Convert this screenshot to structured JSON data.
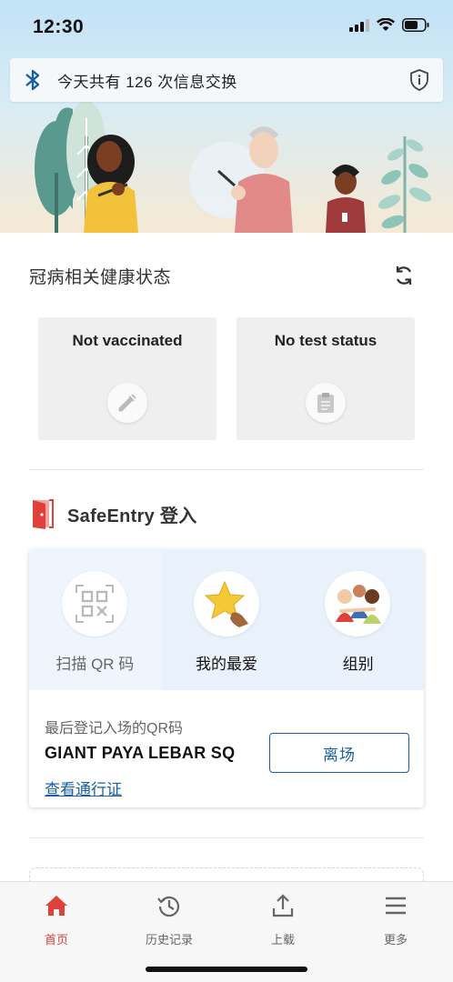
{
  "status_bar": {
    "time": "12:30"
  },
  "bluetooth_banner": {
    "text": "今天共有 126 次信息交换"
  },
  "health": {
    "title": "冠病相关健康状态",
    "vaccination_card": {
      "label": "Not vaccinated",
      "icon": "syringe-icon"
    },
    "test_card": {
      "label": "No test status",
      "icon": "clipboard-icon"
    }
  },
  "safeentry": {
    "title": "SafeEntry 登入",
    "tabs": [
      {
        "label": "扫描 QR 码",
        "icon": "qr-code-icon"
      },
      {
        "label": "我的最爱",
        "icon": "favourite-star-icon"
      },
      {
        "label": "组别",
        "icon": "group-people-icon"
      }
    ],
    "last_checkin_label": "最后登记入场的QR码",
    "last_venue": "GIANT PAYA LEBAR SQ",
    "view_pass_link": "查看通行证",
    "checkout_button": "离场"
  },
  "tabbar": {
    "items": [
      {
        "label": "首页",
        "icon": "home-icon",
        "active": true
      },
      {
        "label": "历史记录",
        "icon": "history-icon",
        "active": false
      },
      {
        "label": "上载",
        "icon": "upload-icon",
        "active": false
      },
      {
        "label": "更多",
        "icon": "menu-icon",
        "active": false
      }
    ]
  },
  "colors": {
    "accent_blue": "#1a5fa3",
    "accent_red": "#e0403a",
    "card_grey": "#efefef",
    "tab_highlight": "#e9f2fb"
  }
}
